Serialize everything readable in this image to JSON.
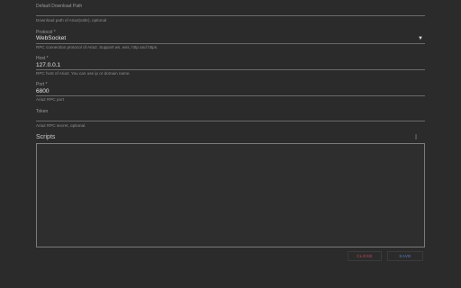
{
  "form": {
    "download_path": {
      "label": "Default Download Path",
      "value": "",
      "hint": "Download path of Aria2(osbr), optional"
    },
    "protocol": {
      "label": "Protocol *",
      "value": "WebSocket",
      "hint": "RPC connection protocol of Aria2. Support ws, wss, http and https."
    },
    "host": {
      "label": "Host *",
      "value": "127.0.0.1",
      "hint": "RPC host of Aria2. You can use ip or domain name."
    },
    "port": {
      "label": "Port *",
      "value": "6800",
      "hint": "Aria2 RPC port"
    },
    "token": {
      "label": "Token",
      "value": "",
      "hint": "Aria2 RPC secret, optional."
    }
  },
  "scripts": {
    "label": "Scripts",
    "menu_icon": "more-vert-icon",
    "content": ""
  },
  "actions": {
    "close_label": "CLOSE",
    "save_label": "SAVE"
  },
  "colors": {
    "background": "#2b2b2b",
    "close_text": "#c24a5a",
    "save_text": "#5a7fd0"
  }
}
